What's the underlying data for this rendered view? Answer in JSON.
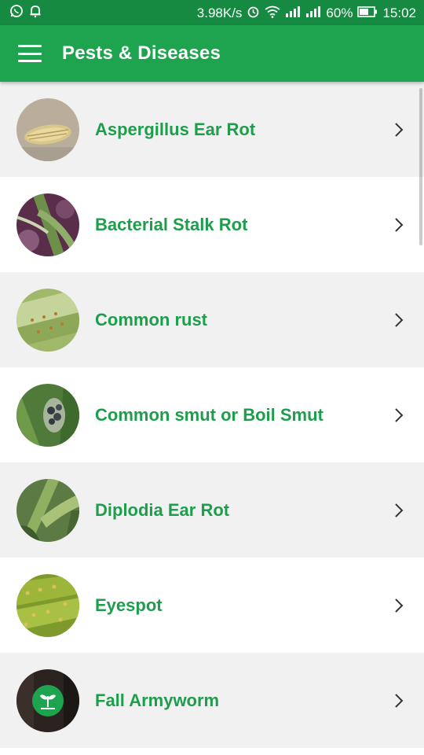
{
  "status_bar": {
    "network_speed": "3.98K/s",
    "battery_percent": "60%",
    "time": "15:02",
    "icons_left": [
      "whatsapp-icon",
      "notification-bell-icon"
    ],
    "icons_right": [
      "alarm-icon",
      "wifi-icon",
      "signal-icon",
      "signal-icon",
      "battery-icon"
    ]
  },
  "app_bar": {
    "title": "Pests & Diseases",
    "menu_icon": "hamburger-menu-icon",
    "color": "#1ea44f"
  },
  "items": [
    {
      "label": "Aspergillus Ear Rot",
      "thumbnail": "corn-ear-photo"
    },
    {
      "label": "Bacterial Stalk Rot",
      "thumbnail": "stalk-photo"
    },
    {
      "label": "Common rust",
      "thumbnail": "leaf-rust-photo"
    },
    {
      "label": "Common smut or Boil Smut",
      "thumbnail": "smut-photo"
    },
    {
      "label": "Diplodia Ear Rot",
      "thumbnail": "corn-ear-photo"
    },
    {
      "label": "Eyespot",
      "thumbnail": "leaf-spot-photo"
    },
    {
      "label": "Fall Armyworm",
      "thumbnail": "app-logo-photo"
    }
  ],
  "colors": {
    "accent_text": "#1e9e4c",
    "row_grey": "#f1f1f1",
    "row_white": "#ffffff"
  }
}
